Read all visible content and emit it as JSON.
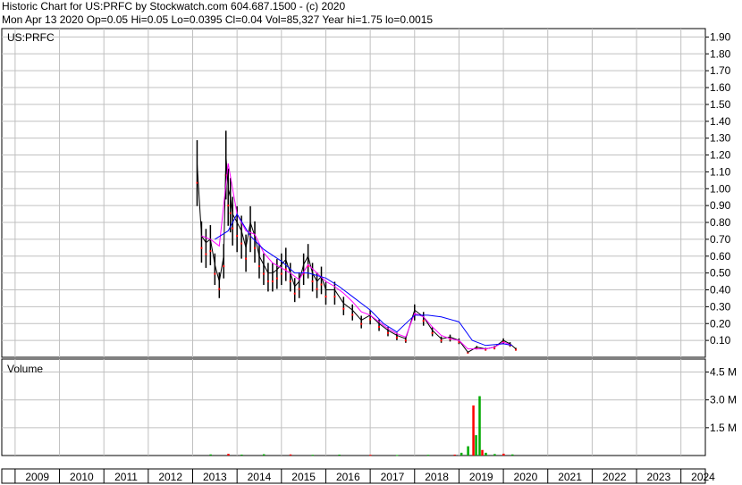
{
  "header": {
    "line1": "Historic Chart for US:PRFC by Stockwatch.com 604.687.1500 - (c) 2020",
    "line2": "Mon Apr 13 2020  Op=0.05  Hi=0.05  Lo=0.0395  Cl=0.04  Vol=85,327  Year hi=1.75  lo=0.0015"
  },
  "chart_data": {
    "type": "line",
    "title": "US:PRFC",
    "price_axis": {
      "ticks": [
        "0.10",
        "0.20",
        "0.30",
        "0.40",
        "0.50",
        "0.60",
        "0.70",
        "0.80",
        "0.90",
        "1.00",
        "1.10",
        "1.20",
        "1.30",
        "1.40",
        "1.50",
        "1.60",
        "1.70",
        "1.80",
        "1.90"
      ],
      "ylim": [
        0.0,
        1.95
      ]
    },
    "volume_panel": {
      "label": "Volume",
      "ticks": [
        "1.5 M",
        "3.0 M",
        "4.5 M"
      ],
      "ylim": [
        0,
        5200000
      ]
    },
    "x_axis": {
      "years": [
        "2009",
        "2010",
        "2011",
        "2012",
        "2013",
        "2014",
        "2015",
        "2016",
        "2017",
        "2018",
        "2019",
        "2020",
        "2021",
        "2022",
        "2023",
        "2024"
      ],
      "xlim": [
        2008.7,
        2024.55
      ]
    },
    "colors": {
      "price": "#000000",
      "close_dots": "#ff0000",
      "ma_short": "#ff00ff",
      "ma_long": "#0000ff",
      "volume_up": "#00aa00",
      "volume_down": "#ff0000",
      "grid": "#c0c0c0"
    },
    "series": [
      {
        "name": "",
        "x": [
          2013.1,
          2013.2,
          2013.3,
          2013.4,
          2013.5,
          2013.6,
          2013.7,
          2013.75,
          2013.8,
          2013.85,
          2013.9,
          2014.0,
          2014.1,
          2014.2,
          2014.3,
          2014.4,
          2014.5,
          2014.6,
          2014.7,
          2014.8,
          2014.9,
          2015.0,
          2015.1,
          2015.2,
          2015.3,
          2015.4,
          2015.5,
          2015.6,
          2015.7,
          2015.8,
          2015.9,
          2016.0,
          2016.2,
          2016.4,
          2016.6,
          2016.8,
          2017.0,
          2017.2,
          2017.4,
          2017.6,
          2017.8,
          2018.0,
          2018.2,
          2018.4,
          2018.6,
          2018.8,
          2019.0,
          2019.2,
          2019.4,
          2019.6,
          2019.8,
          2020.0,
          2020.15,
          2020.28
        ],
        "y": [
          1.15,
          0.72,
          0.68,
          0.7,
          0.55,
          0.45,
          0.6,
          1.2,
          1.0,
          0.95,
          0.85,
          0.8,
          0.75,
          0.65,
          0.8,
          0.72,
          0.6,
          0.55,
          0.5,
          0.5,
          0.52,
          0.55,
          0.58,
          0.5,
          0.42,
          0.45,
          0.55,
          0.6,
          0.5,
          0.45,
          0.48,
          0.4,
          0.4,
          0.32,
          0.28,
          0.22,
          0.25,
          0.2,
          0.16,
          0.13,
          0.11,
          0.28,
          0.24,
          0.16,
          0.11,
          0.12,
          0.1,
          0.03,
          0.06,
          0.05,
          0.06,
          0.1,
          0.08,
          0.05
        ]
      },
      {
        "name": "",
        "x": [
          2013.2,
          2013.4,
          2013.6,
          2013.8,
          2014.0,
          2014.2,
          2014.4,
          2014.6,
          2014.8,
          2015.0,
          2015.2,
          2015.4,
          2015.6,
          2015.8,
          2016.0,
          2016.2,
          2016.4,
          2016.6,
          2016.8,
          2017.0,
          2017.2,
          2017.4,
          2017.6,
          2017.8,
          2018.0,
          2018.2,
          2018.4,
          2018.6,
          2018.8,
          2019.0,
          2019.2,
          2019.4,
          2019.6,
          2019.8,
          2020.0,
          2020.2
        ],
        "y": [
          0.72,
          0.7,
          0.66,
          1.15,
          0.85,
          0.75,
          0.73,
          0.62,
          0.56,
          0.53,
          0.5,
          0.46,
          0.55,
          0.5,
          0.45,
          0.42,
          0.38,
          0.33,
          0.27,
          0.25,
          0.21,
          0.17,
          0.14,
          0.12,
          0.26,
          0.24,
          0.18,
          0.13,
          0.11,
          0.1,
          0.05,
          0.05,
          0.05,
          0.06,
          0.09,
          0.07
        ]
      },
      {
        "name": "",
        "x": [
          2013.5,
          2013.8,
          2014.0,
          2014.3,
          2014.6,
          2015.0,
          2015.3,
          2015.6,
          2016.0,
          2016.3,
          2016.6,
          2017.0,
          2017.3,
          2017.6,
          2018.0,
          2018.3,
          2018.6,
          2019.0,
          2019.3,
          2019.6,
          2020.0,
          2020.2
        ],
        "y": [
          0.7,
          0.75,
          0.85,
          0.72,
          0.64,
          0.57,
          0.5,
          0.5,
          0.47,
          0.42,
          0.36,
          0.28,
          0.2,
          0.15,
          0.25,
          0.25,
          0.24,
          0.21,
          0.1,
          0.07,
          0.08,
          0.07
        ]
      }
    ],
    "volume_bars": [
      {
        "x": 2013.4,
        "v": 60000
      },
      {
        "x": 2013.8,
        "v": 90000
      },
      {
        "x": 2014.1,
        "v": 50000
      },
      {
        "x": 2014.6,
        "v": 70000
      },
      {
        "x": 2015.2,
        "v": 60000
      },
      {
        "x": 2015.7,
        "v": 40000
      },
      {
        "x": 2016.3,
        "v": 50000
      },
      {
        "x": 2017.0,
        "v": 40000
      },
      {
        "x": 2017.6,
        "v": 30000
      },
      {
        "x": 2018.3,
        "v": 40000
      },
      {
        "x": 2018.9,
        "v": 50000
      },
      {
        "x": 2019.05,
        "v": 150000
      },
      {
        "x": 2019.2,
        "v": 500000
      },
      {
        "x": 2019.32,
        "v": 2700000
      },
      {
        "x": 2019.38,
        "v": 1100000
      },
      {
        "x": 2019.46,
        "v": 3200000
      },
      {
        "x": 2019.52,
        "v": 300000
      },
      {
        "x": 2019.6,
        "v": 150000
      },
      {
        "x": 2019.8,
        "v": 80000
      },
      {
        "x": 2020.0,
        "v": 100000
      },
      {
        "x": 2020.2,
        "v": 60000
      }
    ]
  }
}
